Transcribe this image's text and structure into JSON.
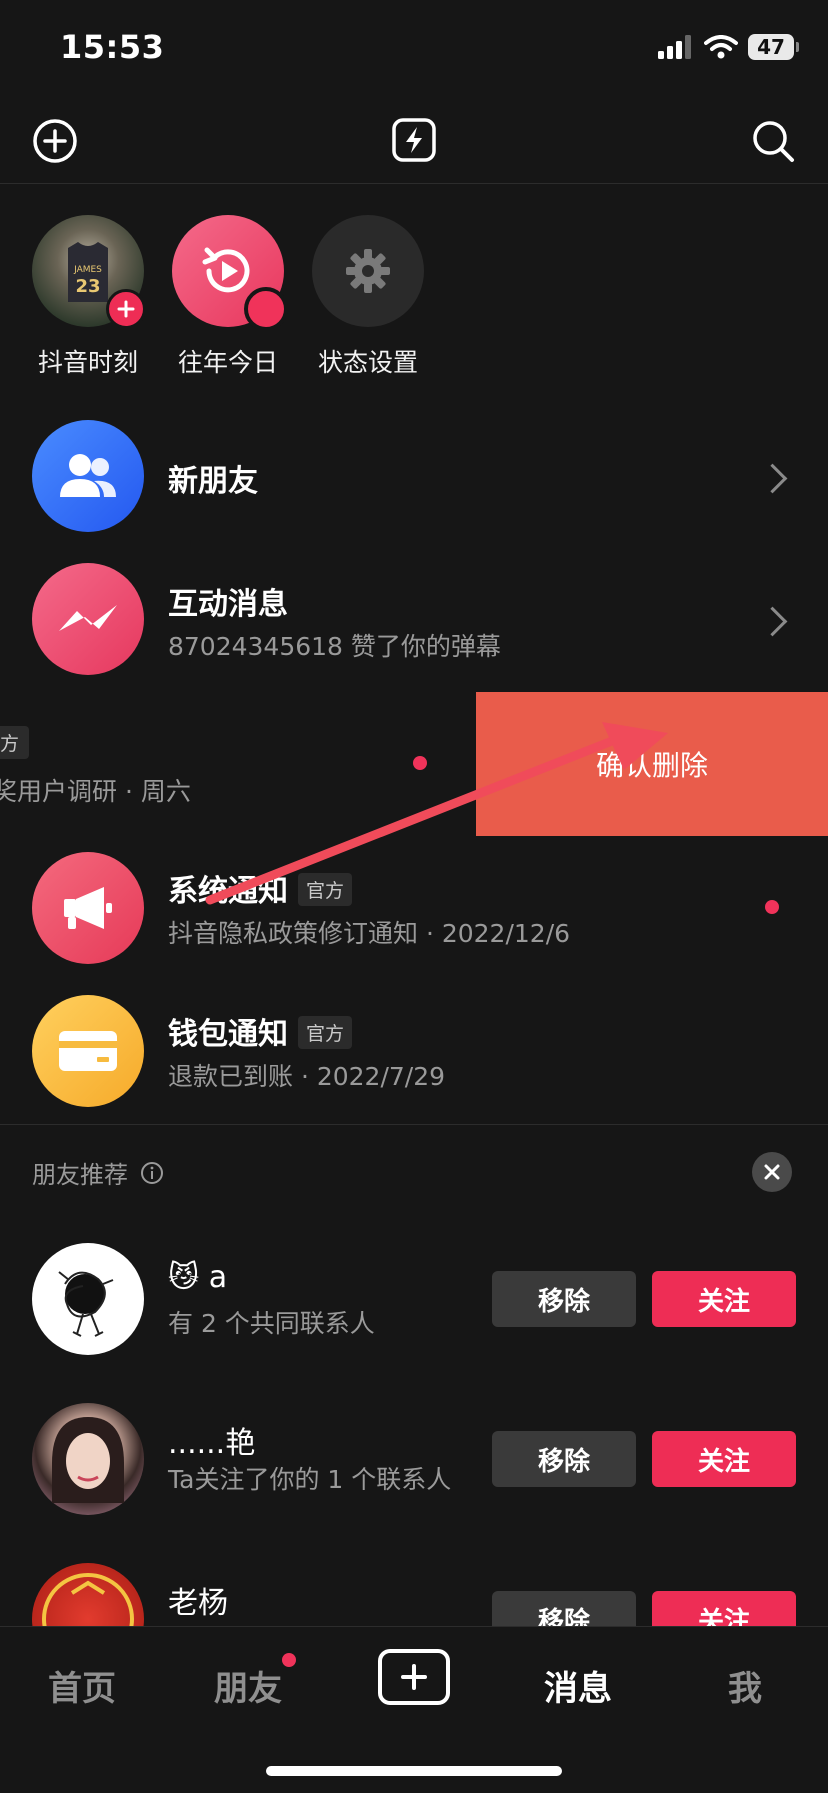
{
  "status_bar": {
    "time": "15:53",
    "battery": "47"
  },
  "stories": [
    {
      "label": "抖音时刻"
    },
    {
      "label": "往年今日"
    },
    {
      "label": "状态设置"
    }
  ],
  "new_friends": {
    "title": "新朋友"
  },
  "interactions": {
    "title": "互动消息",
    "subtitle": "87024345618 赞了你的弹幕"
  },
  "swiped_row": {
    "tag": "方",
    "subtitle": "奖用户调研 · 周六",
    "action": "确认删除",
    "action_partial": "删除"
  },
  "system_notice": {
    "title": "系统通知",
    "tag": "官方",
    "subtitle": "抖音隐私政策修订通知 · 2022/12/6"
  },
  "wallet_notice": {
    "title": "钱包通知",
    "tag": "官方",
    "subtitle": "退款已到账 · 2022/7/29"
  },
  "recommend": {
    "header": "朋友推荐",
    "remove_label": "移除",
    "follow_label": "关注",
    "users": [
      {
        "name": "😼 a",
        "desc": "有 2 个共同联系人"
      },
      {
        "name": "......艳",
        "desc": "Ta关注了你的 1 个联系人"
      },
      {
        "name": "老杨",
        "desc": ""
      }
    ]
  },
  "bottom_nav": {
    "home": "首页",
    "friends": "朋友",
    "messages": "消息",
    "me": "我"
  },
  "colors": {
    "accent_red": "#ee2d55",
    "delete_bg": "#e95c4b",
    "arrow": "#f04b5a"
  }
}
